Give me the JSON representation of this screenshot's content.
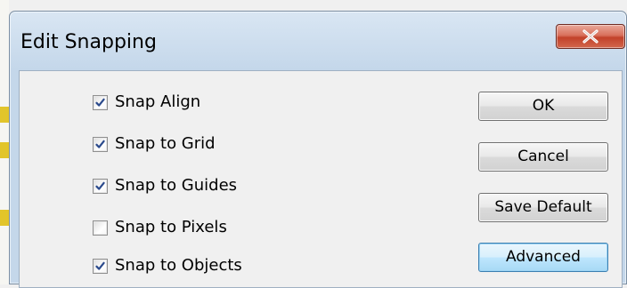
{
  "dialog": {
    "title": "Edit Snapping",
    "close_icon": "close-x-icon"
  },
  "options": [
    {
      "label": "Snap Align",
      "checked": true
    },
    {
      "label": "Snap to Grid",
      "checked": true
    },
    {
      "label": "Snap to Guides",
      "checked": true
    },
    {
      "label": "Snap to Pixels",
      "checked": false
    },
    {
      "label": "Snap to Objects",
      "checked": true
    }
  ],
  "buttons": {
    "ok": "OK",
    "cancel": "Cancel",
    "save_default": "Save Default",
    "advanced": "Advanced"
  },
  "colors": {
    "close_button": "#c94a33",
    "focus_border": "#3c7fb1"
  }
}
